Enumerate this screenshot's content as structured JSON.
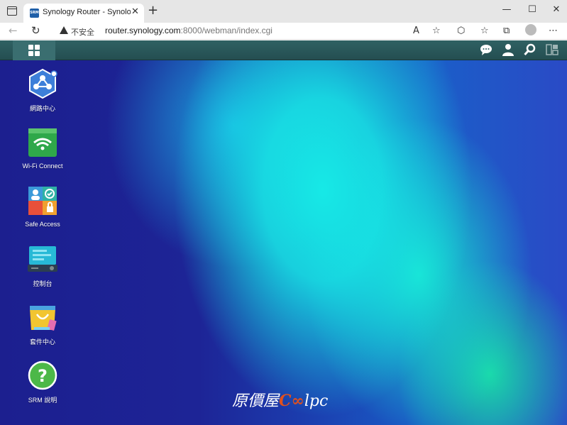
{
  "browser": {
    "tab_title": "Synology Router - SynologyRouter",
    "favicon_text": "SRM",
    "new_tab": "+",
    "tab_close": "✕",
    "minimize": "—",
    "maximize": "☐",
    "close": "✕",
    "security_warning": "不安全",
    "url_host": "router.synology.com",
    "url_path": ":8000/webman/index.cgi"
  },
  "desktop": {
    "apps": [
      {
        "label": "網路中心",
        "icon": "network-center-icon"
      },
      {
        "label": "Wi-Fi Connect",
        "icon": "wifi-connect-icon"
      },
      {
        "label": "Safe Access",
        "icon": "safe-access-icon"
      },
      {
        "label": "控制台",
        "icon": "control-panel-icon"
      },
      {
        "label": "套件中心",
        "icon": "package-center-icon"
      },
      {
        "label": "SRM 說明",
        "icon": "help-icon"
      }
    ],
    "watermark_prefix": "原價屋",
    "watermark_c": "C",
    "watermark_oo": "∞",
    "watermark_suffix": "lpc"
  },
  "colors": {
    "taskbar": "#2f6163",
    "desktop_base": "#1c1f8f",
    "desktop_highlight": "#17e9e6"
  }
}
